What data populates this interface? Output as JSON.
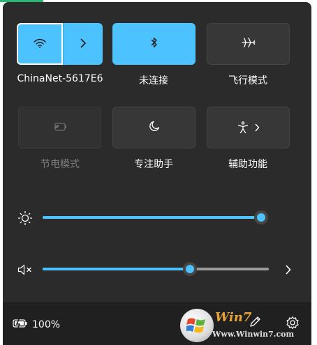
{
  "colors": {
    "accent": "#4cc2ff",
    "panel": "#2b2b2b",
    "footer": "#202020"
  },
  "tiles": {
    "wifi": {
      "label": "ChinaNet-5617E6",
      "icon": "wifi-icon",
      "arrow_icon": "chevron-right-icon",
      "state": "on"
    },
    "bluetooth": {
      "label": "未连接",
      "icon": "bluetooth-icon",
      "state": "on"
    },
    "airplane": {
      "label": "飞行模式",
      "icon": "airplane-icon",
      "state": "off"
    },
    "battery_saver": {
      "label": "节电模式",
      "icon": "battery-saver-icon",
      "state": "disabled"
    },
    "focus": {
      "label": "专注助手",
      "icon": "moon-icon",
      "state": "off"
    },
    "accessibility": {
      "label": "辅助功能",
      "icon": "accessibility-icon",
      "state": "off"
    }
  },
  "sliders": {
    "brightness": {
      "icon": "brightness-icon",
      "level": 1.0
    },
    "volume": {
      "icon": "volume-muted-icon",
      "level": 0.65
    }
  },
  "footer": {
    "battery_percent": "100%",
    "battery_icon": "battery-charging-icon",
    "edit_icon": "pencil-icon",
    "settings_icon": "gear-icon"
  },
  "watermark": {
    "logo": "Win7",
    "url": "Www.Winwin7.com"
  }
}
